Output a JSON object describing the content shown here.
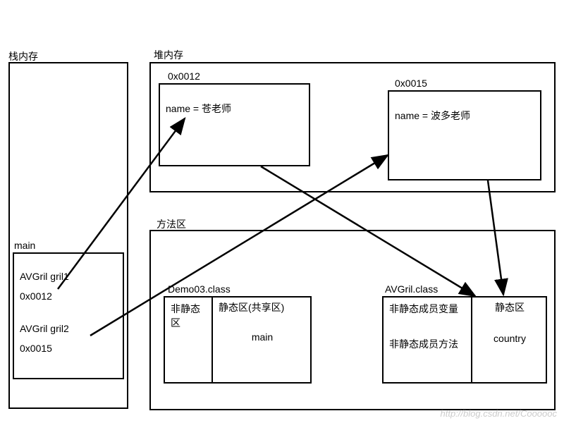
{
  "stack": {
    "title": "栈内存",
    "frame": {
      "label": "main",
      "line1": "AVGril gril1",
      "line2": "0x0012",
      "line3": "AVGril gril2",
      "line4": "0x0015"
    }
  },
  "heap": {
    "title": "堆内存",
    "obj1": {
      "addr": "0x0012",
      "field": "name = 苍老师"
    },
    "obj2": {
      "addr": "0x0015",
      "field": "name = 波多老师"
    }
  },
  "method_area": {
    "title": "方法区",
    "class1": {
      "name": "Demo03.class",
      "c1": "非静态区",
      "c2": "静态区(共享区)",
      "c2_item": "main"
    },
    "class2": {
      "name": "AVGril.class",
      "c1a": "非静态成员变量",
      "c1b": "非静态成员方法",
      "c2": "静态区",
      "c2_item": "country"
    }
  },
  "watermark": "http://blog.csdn.net/Coooooc"
}
